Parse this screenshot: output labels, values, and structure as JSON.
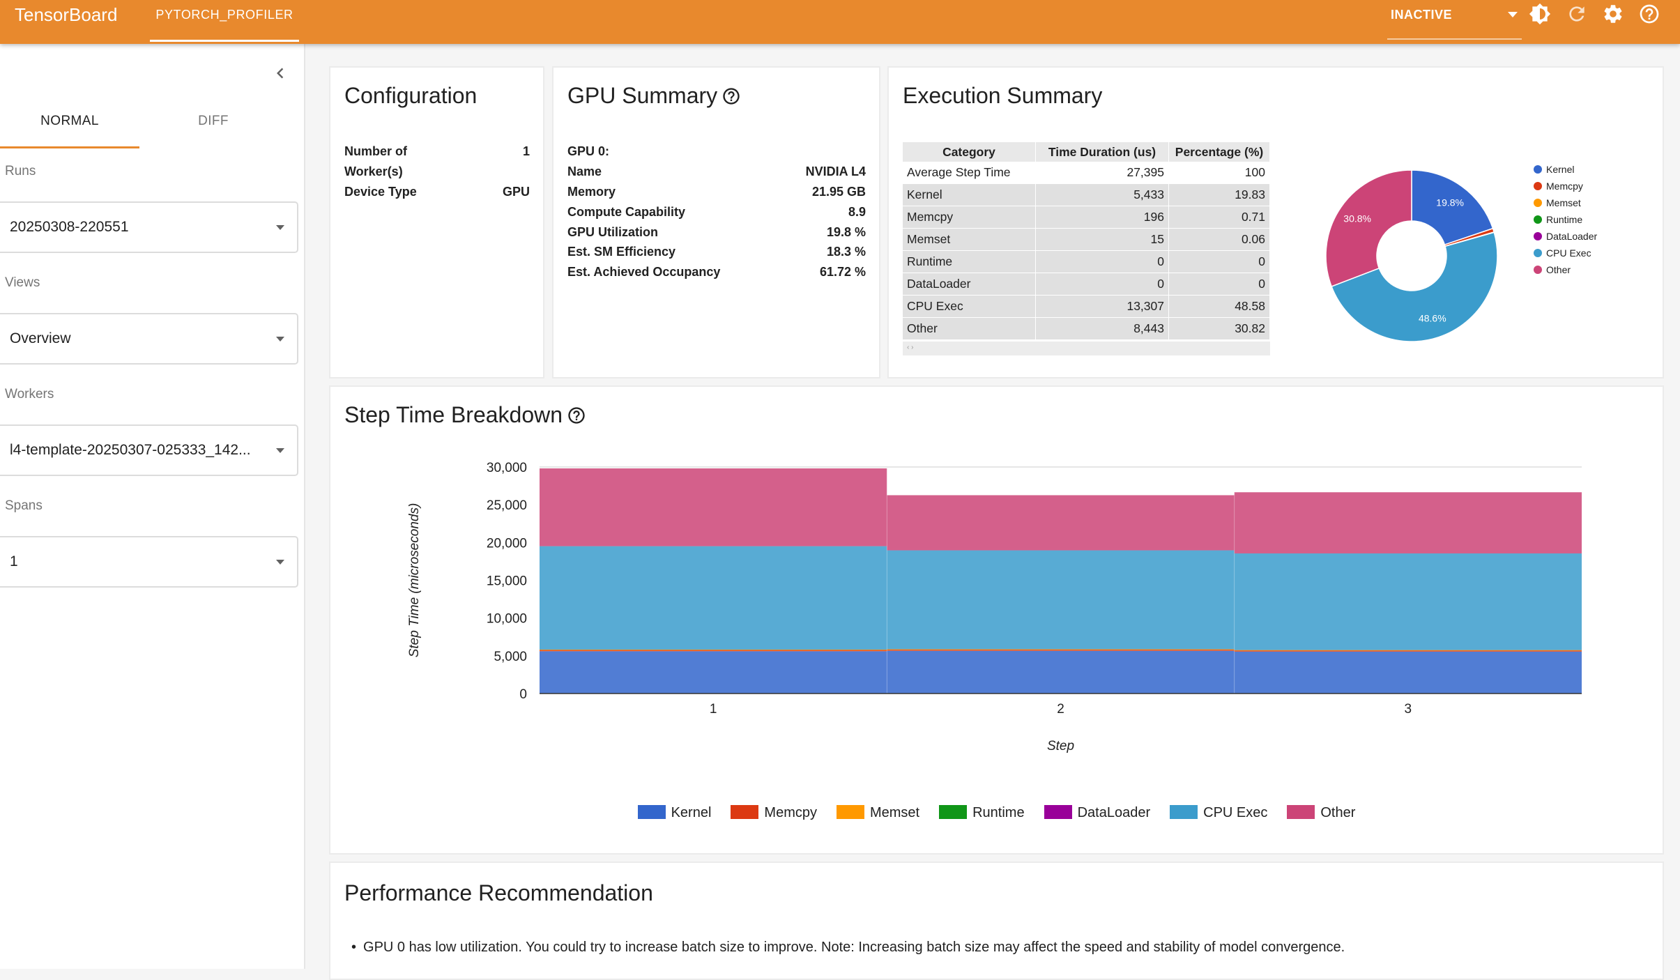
{
  "topbar": {
    "brand": "TensorBoard",
    "plugin_tab": "PYTORCH_PROFILER",
    "status_select": "INACTIVE",
    "icons": [
      "brightness-icon",
      "refresh-icon",
      "settings-icon",
      "help-icon"
    ]
  },
  "sidebar": {
    "tabs": {
      "normal": "NORMAL",
      "diff": "DIFF"
    },
    "runs": {
      "label": "Runs",
      "value": "20250308-220551"
    },
    "views": {
      "label": "Views",
      "value": "Overview"
    },
    "workers": {
      "label": "Workers",
      "value": "l4-template-20250307-025333_142..."
    },
    "spans": {
      "label": "Spans",
      "value": "1"
    }
  },
  "configuration": {
    "title": "Configuration",
    "rows": [
      {
        "key_line1": "Number of",
        "key_line2": "Worker(s)",
        "value": "1"
      },
      {
        "key": "Device Type",
        "value": "GPU"
      }
    ]
  },
  "gpu_summary": {
    "title": "GPU Summary",
    "gpu_header": "GPU 0:",
    "rows": [
      {
        "key": "Name",
        "value": "NVIDIA L4"
      },
      {
        "key": "Memory",
        "value": "21.95 GB"
      },
      {
        "key": "Compute Capability",
        "value": "8.9"
      },
      {
        "key": "GPU Utilization",
        "value": "19.8 %"
      },
      {
        "key": "Est. SM Efficiency",
        "value": "18.3 %"
      },
      {
        "key": "Est. Achieved Occupancy",
        "value": "61.72 %"
      }
    ]
  },
  "execution_summary": {
    "title": "Execution Summary",
    "columns": [
      "Category",
      "Time Duration (us)",
      "Percentage (%)"
    ],
    "rows": [
      [
        "Average Step Time",
        "27,395",
        "100"
      ],
      [
        "Kernel",
        "5,433",
        "19.83"
      ],
      [
        "Memcpy",
        "196",
        "0.71"
      ],
      [
        "Memset",
        "15",
        "0.06"
      ],
      [
        "Runtime",
        "0",
        "0"
      ],
      [
        "DataLoader",
        "0",
        "0"
      ],
      [
        "CPU Exec",
        "13,307",
        "48.58"
      ],
      [
        "Other",
        "8,443",
        "30.82"
      ]
    ],
    "pagination": "‹ ›"
  },
  "step_breakdown": {
    "title": "Step Time Breakdown"
  },
  "recommendation": {
    "title": "Performance Recommendation",
    "items": [
      "GPU 0 has low utilization. You could try to increase batch size to improve. Note: Increasing batch size may affect the speed and stability of model convergence."
    ]
  },
  "colors": {
    "topbar": "#e8892d",
    "Kernel": "#3366cc",
    "Memcpy": "#dc3912",
    "Memset": "#ff9900",
    "Runtime": "#109618",
    "DataLoader": "#990099",
    "CPU Exec": "#3b9ccc",
    "Other": "#cc4477"
  },
  "chart_data": [
    {
      "type": "pie",
      "chart_style": "donut",
      "labels": [
        "Kernel",
        "Memcpy",
        "Memset",
        "Runtime",
        "DataLoader",
        "CPU Exec",
        "Other"
      ],
      "values": [
        19.83,
        0.71,
        0.06,
        0,
        0,
        48.58,
        30.82
      ],
      "slice_labels": [
        "19.8%",
        "",
        "",
        "",
        "",
        "48.6%",
        "30.8%"
      ],
      "legend_placement": "right"
    },
    {
      "type": "area",
      "stacked": true,
      "step_style": true,
      "title": "",
      "xlabel": "Step",
      "ylabel": "Step Time (microseconds)",
      "categories": [
        "1",
        "2",
        "3"
      ],
      "ylim": [
        0,
        30000
      ],
      "yticks": [
        "0",
        "5,000",
        "10,000",
        "15,000",
        "20,000",
        "25,000",
        "30,000"
      ],
      "series": [
        {
          "name": "Kernel",
          "values": [
            5600,
            5650,
            5550
          ]
        },
        {
          "name": "Memcpy",
          "values": [
            200,
            200,
            190
          ]
        },
        {
          "name": "Memset",
          "values": [
            15,
            15,
            15
          ]
        },
        {
          "name": "Runtime",
          "values": [
            0,
            0,
            0
          ]
        },
        {
          "name": "DataLoader",
          "values": [
            0,
            0,
            0
          ]
        },
        {
          "name": "CPU Exec",
          "values": [
            13700,
            13100,
            12800
          ]
        },
        {
          "name": "Other",
          "values": [
            10300,
            7300,
            8100
          ]
        }
      ],
      "legend_placement": "bottom",
      "grid": false
    }
  ]
}
